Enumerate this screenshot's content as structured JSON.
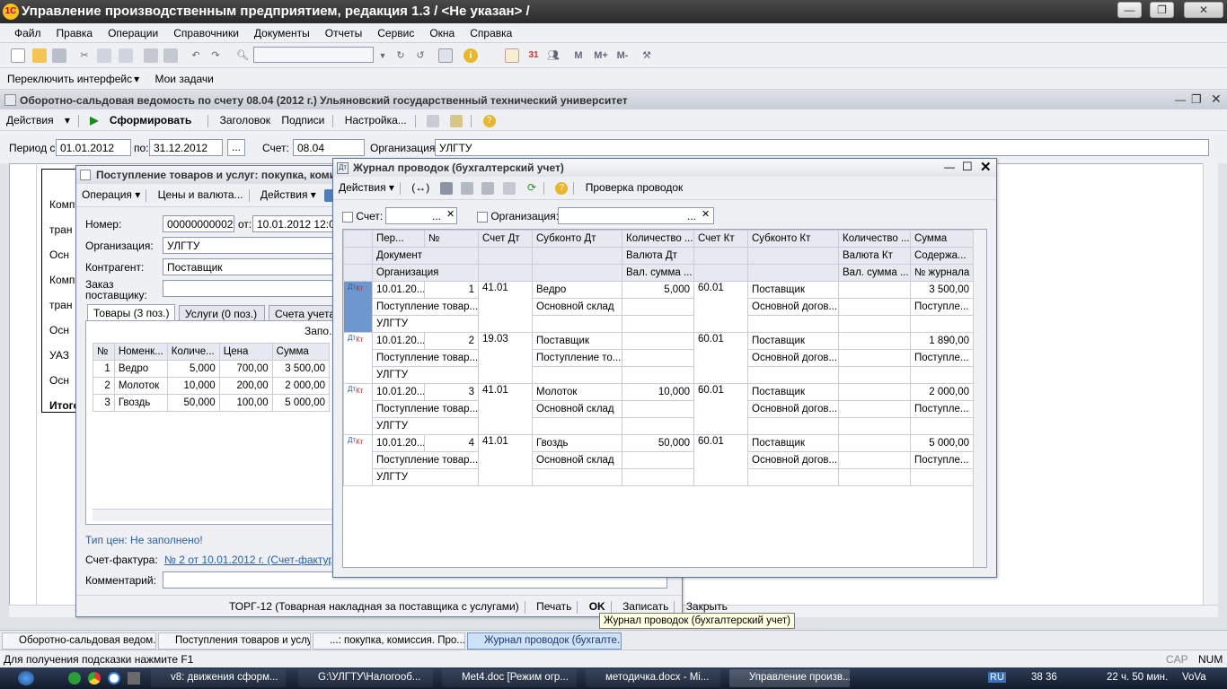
{
  "app": {
    "title": "Управление производственным предприятием, редакция 1.3 / <Не указан> /",
    "logo": "1С"
  },
  "menu": [
    "Файл",
    "Правка",
    "Операции",
    "Справочники",
    "Документы",
    "Отчеты",
    "Сервис",
    "Окна",
    "Справка"
  ],
  "subtoolbar": {
    "switch": "Переключить интерфейс",
    "tasks": "Мои задачи"
  },
  "osv": {
    "title": "Оборотно-сальдовая ведомость по счету 08.04 (2012 г.) Ульяновский государственный технический университет",
    "actions": "Действия",
    "generate": "Сформировать",
    "header": "Заголовок",
    "signatures": "Подписи",
    "settings": "Настройка...",
    "period_from_label": "Период с:",
    "period_from": "01.01.2012",
    "period_to_label": "по:",
    "period_to": "31.12.2012",
    "account_label": "Счет:",
    "account": "08.04",
    "org_label": "Организация:",
    "org": "УЛГТУ",
    "rows": [
      "Комп",
      "тран",
      "Осн",
      "Комп",
      "тран",
      "Осн",
      "УАЗ",
      "Осн",
      "Итого"
    ]
  },
  "receipt": {
    "title": "Поступление товаров и услуг: покупка, комиссия. Проведен",
    "operation": "Операция",
    "prices": "Цены и валюта...",
    "actions": "Действия",
    "number_label": "Номер:",
    "number": "00000000002",
    "date_label": "от:",
    "date": "10.01.2012 12:00",
    "org_label": "Организация:",
    "org": "УЛГТУ",
    "contractor_label": "Контрагент:",
    "contractor": "Поставщик",
    "order_label1": "Заказ",
    "order_label2": "поставщику:",
    "tabs": [
      "Товары (3 поз.)",
      "Услуги (0 поз.)",
      "Счета учета"
    ],
    "fill": "Запо...",
    "cols": [
      "№",
      "Номенк...",
      "Количе...",
      "Цена",
      "Сумма"
    ],
    "items": [
      [
        "1",
        "Ведро",
        "5,000",
        "700,00",
        "3 500,00"
      ],
      [
        "2",
        "Молоток",
        "10,000",
        "200,00",
        "2 000,00"
      ],
      [
        "3",
        "Гвоздь",
        "50,000",
        "100,00",
        "5 000,00"
      ]
    ],
    "price_type": "Тип цен: Не заполнено!",
    "invoice_label": "Счет-фактура:",
    "invoice": "№ 2 от 10.01.2012 г. (Счет-фактура полученный)",
    "comment_label": "Комментарий:",
    "torg": "ТОРГ-12 (Товарная накладная за поставщика с услугами)",
    "print": "Печать",
    "ok": "OK",
    "save": "Записать",
    "close": "Закрыть"
  },
  "journal": {
    "title": "Журнал проводок (бухгалтерский учет)",
    "actions": "Действия",
    "check": "Проверка проводок",
    "account_label": "Счет:",
    "org_label": "Организация:",
    "head1": [
      "Пер...",
      "№",
      "Счет Дт",
      "Субконто Дт",
      "Количество ...",
      "Счет Кт",
      "Субконто Кт",
      "Количество ...",
      "Сумма"
    ],
    "head2": [
      "Документ",
      "",
      "Валюта Дт",
      "",
      "",
      "Валюта Кт",
      "Содержа..."
    ],
    "head3": [
      "Организация",
      "",
      "Вал. сумма ...",
      "",
      "",
      "Вал. сумма ...",
      "№ журнала"
    ],
    "rows": [
      {
        "date": "10.01.20...",
        "n": "1",
        "dt": "41.01",
        "sub_dt": "Ведро",
        "qty_dt": "5,000",
        "kt": "60.01",
        "sub_kt": "Поставщик",
        "sum": "3 500,00",
        "doc": "Поступление товар...",
        "sub_dt2": "Основной склад",
        "sub_kt2": "Основной догов...",
        "content": "Поступле...",
        "org": "УЛГТУ"
      },
      {
        "date": "10.01.20...",
        "n": "2",
        "dt": "19.03",
        "sub_dt": "Поставщик",
        "qty_dt": "",
        "kt": "60.01",
        "sub_kt": "Поставщик",
        "sum": "1 890,00",
        "doc": "Поступление товар...",
        "sub_dt2": "Поступление то...",
        "sub_kt2": "Основной догов...",
        "content": "Поступле...",
        "org": "УЛГТУ"
      },
      {
        "date": "10.01.20...",
        "n": "3",
        "dt": "41.01",
        "sub_dt": "Молоток",
        "qty_dt": "10,000",
        "kt": "60.01",
        "sub_kt": "Поставщик",
        "sum": "2 000,00",
        "doc": "Поступление товар...",
        "sub_dt2": "Основной склад",
        "sub_kt2": "Основной догов...",
        "content": "Поступле...",
        "org": "УЛГТУ"
      },
      {
        "date": "10.01.20...",
        "n": "4",
        "dt": "41.01",
        "sub_dt": "Гвоздь",
        "qty_dt": "50,000",
        "kt": "60.01",
        "sub_kt": "Поставщик",
        "sum": "5 000,00",
        "doc": "Поступление товар...",
        "sub_dt2": "Основной склад",
        "sub_kt2": "Основной догов...",
        "content": "Поступле...",
        "org": "УЛГТУ"
      }
    ]
  },
  "tooltip": "Журнал проводок (бухгалтерский учет)",
  "mdi_tabs": [
    "Оборотно-сальдовая ведом...",
    "Поступления товаров и услуг",
    "...: покупка, комиссия. Про...",
    "Журнал проводок (бухгалте..."
  ],
  "status": {
    "hint": "Для получения подсказки нажмите F1",
    "cap": "CAP",
    "num": "NUM"
  },
  "taskbar": {
    "items": [
      "v8: движения сформ...",
      "G:\\УЛГТУ\\Налогооб...",
      "Met4.doc [Режим огр...",
      "методичка.docx - Mi...",
      "Управление произв..."
    ],
    "lang": "RU",
    "tray": "38 36",
    "clock": "22 ч. 50 мин.",
    "user": "VoVa"
  }
}
